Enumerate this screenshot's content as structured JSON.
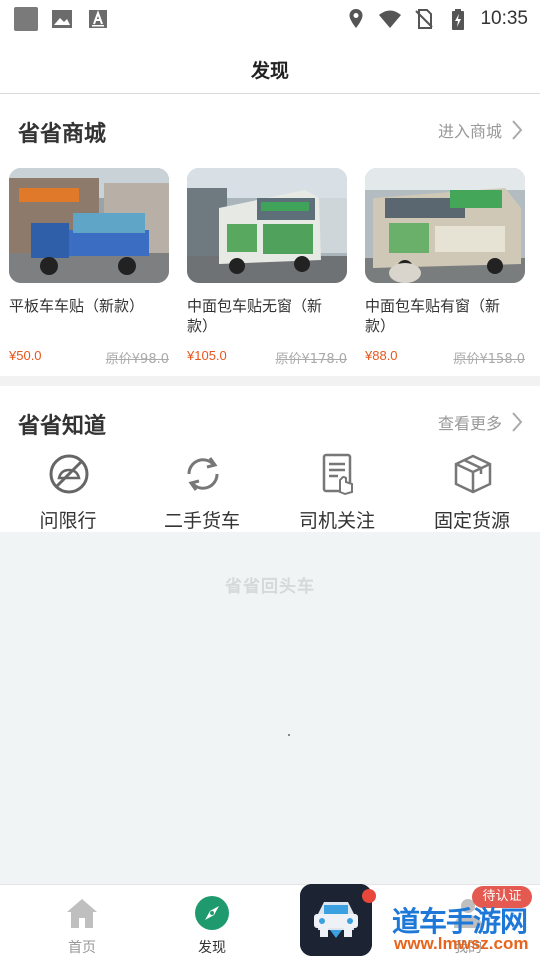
{
  "status_bar": {
    "time": "10:35",
    "left_icons": [
      "app-square-icon",
      "image-icon",
      "text-a-icon"
    ],
    "right_icons": [
      "location-icon",
      "wifi-icon",
      "no-sim-icon",
      "battery-charging-icon"
    ]
  },
  "header": {
    "title": "发现"
  },
  "mall": {
    "title": "省省商城",
    "link_label": "进入商城",
    "products": [
      {
        "name": "平板车车贴（新款）",
        "price": "¥50.0",
        "original_price": "原价¥98.0"
      },
      {
        "name": "中面包车贴无窗（新款）",
        "price": "¥105.0",
        "original_price": "原价¥178.0"
      },
      {
        "name": "中面包车贴有窗（新款）",
        "price": "¥88.0",
        "original_price": "原价¥158.0"
      }
    ]
  },
  "knowledge": {
    "title": "省省知道",
    "link_label": "查看更多",
    "items": [
      {
        "label": "问限行",
        "icon": "no-entry-icon"
      },
      {
        "label": "二手货车",
        "icon": "refresh-icon"
      },
      {
        "label": "司机关注",
        "icon": "document-hand-icon"
      },
      {
        "label": "固定货源",
        "icon": "box-icon"
      }
    ]
  },
  "content": {
    "watermark": "省省回头车"
  },
  "tab_bar": {
    "tabs": [
      {
        "label": "首页",
        "icon": "home-icon"
      },
      {
        "label": "发现",
        "icon": "compass-icon",
        "active": true
      },
      {
        "label": "我的",
        "icon": "user-icon"
      }
    ],
    "verify_badge": "待认证"
  },
  "overlay": {
    "site_title": "道车手游网",
    "site_url": "www.lmwsz.com"
  },
  "colors": {
    "accent_green": "#1f9a6e",
    "price_orange": "#e8561c",
    "badge_red": "#e45a50"
  }
}
